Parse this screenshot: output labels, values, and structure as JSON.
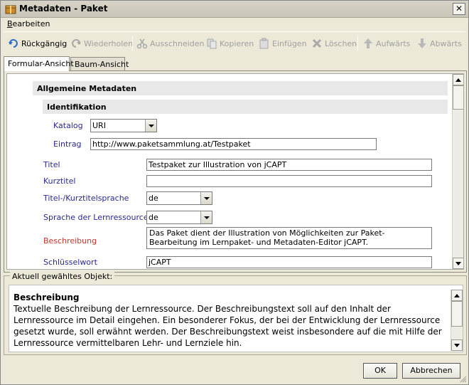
{
  "window": {
    "title": "Metadaten - Paket",
    "close_symbol": "✕"
  },
  "menu": {
    "edit_prefix": "B",
    "edit_rest": "earbeiten"
  },
  "toolbar": {
    "undo": "Rückgängig",
    "redo": "Wiederholen",
    "cut": "Ausschneiden",
    "copy": "Kopieren",
    "paste": "Einfügen",
    "delete": "Löschen",
    "up": "Aufwärts",
    "down": "Abwärts"
  },
  "tabs": {
    "form_view": "Formular-Ansicht",
    "tree_view": "Baum-Ansicht"
  },
  "form": {
    "section_general": "Allgemeine Metadaten",
    "section_identification": "Identifikation",
    "catalog_label": "Katalog",
    "catalog_value": "URI",
    "entry_label": "Eintrag",
    "entry_value": "http://www.paketsammlung.at/Testpaket",
    "title_label": "Titel",
    "title_value": "Testpaket zur Illustration von jCAPT",
    "short_title_label": "Kurztitel",
    "short_title_value": "",
    "title_lang_label": "Titel-/Kurztitelsprache",
    "title_lang_value": "de",
    "resource_lang_label": "Sprache der Lernressource",
    "resource_lang_value": "de",
    "description_label": "Beschreibung",
    "description_value": "Das Paket dient der Illustration von Möglichkeiten zur Paket-Bearbeitung im Lernpaket- und Metadaten-Editor jCAPT.",
    "keyword_label": "Schlüsselwort",
    "keyword_value": "jCAPT"
  },
  "info": {
    "legend": "Aktuell gewähltes Objekt:",
    "title": "Beschreibung",
    "text": "Textuelle Beschreibung der Lernressource. Der Beschreibungstext soll auf den Inhalt der Lernressource im Detail eingehen. Ein besonderer Fokus, der bei der Entwicklung der Lernressource gesetzt wurde, soll erwähnt werden. Der Beschreibungstext weist insbesondere auf die mit Hilfe der Lernressource vermittelbaren Lehr- und Lernziele hin."
  },
  "buttons": {
    "ok": "OK",
    "cancel": "Abbrechen"
  }
}
